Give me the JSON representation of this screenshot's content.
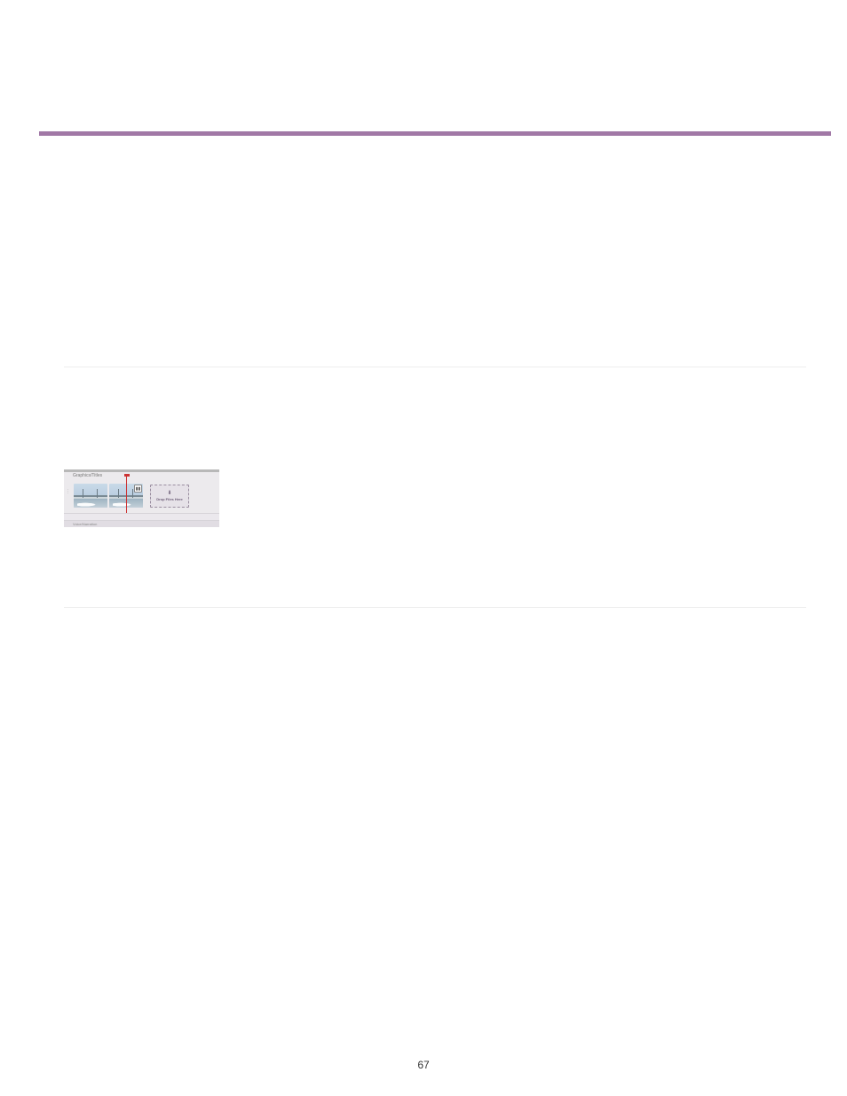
{
  "page_number": "67",
  "bullets": [
    "",
    "",
    "",
    ""
  ],
  "figure": {
    "track_top": "Graphics/Titles",
    "track_bottom": "Voice/Narration",
    "drop_label": "Drop Files Here"
  }
}
